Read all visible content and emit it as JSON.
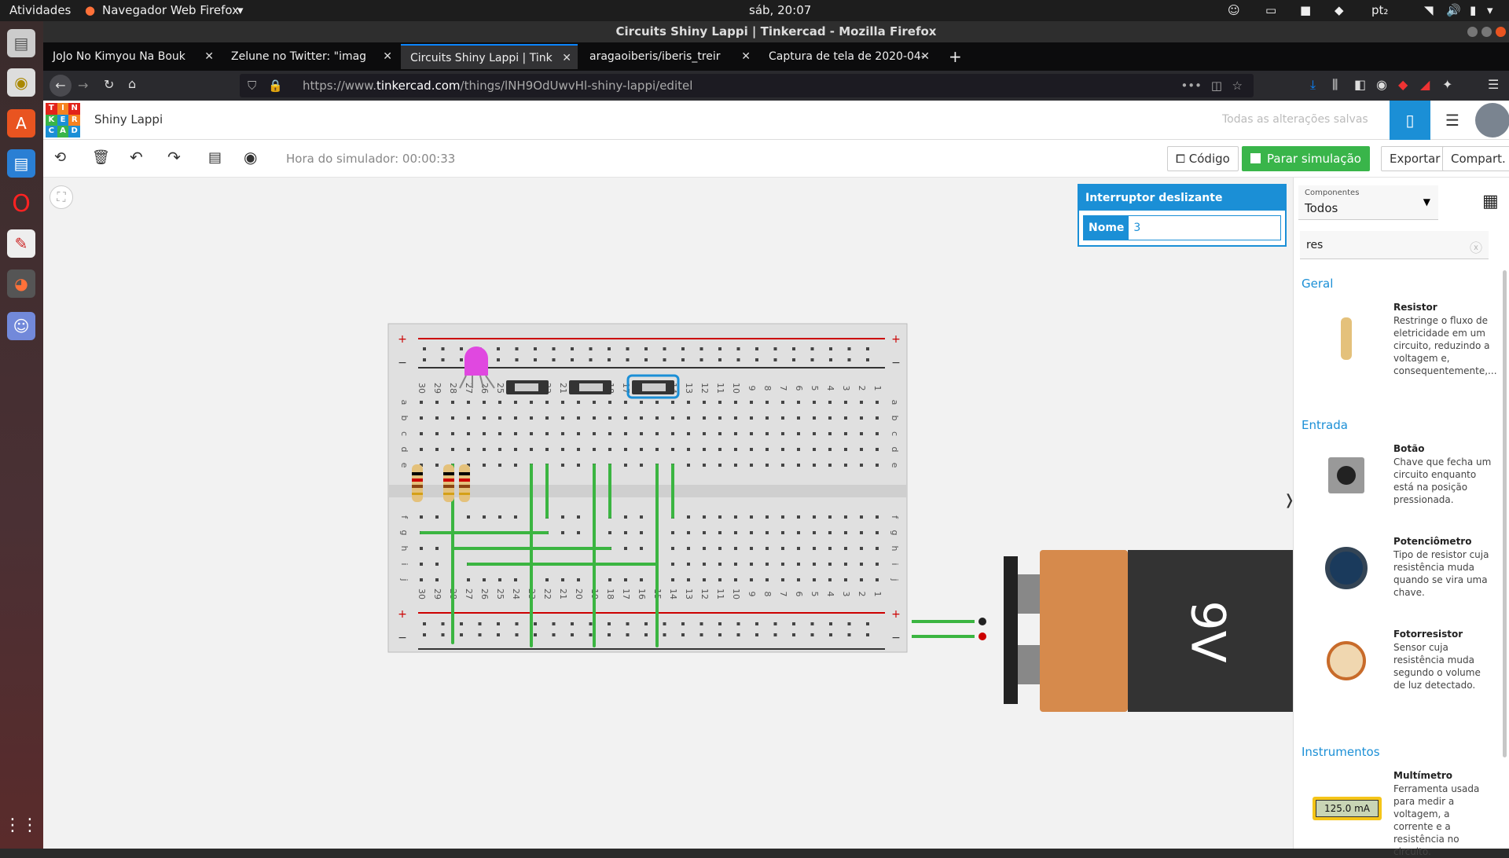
{
  "os": {
    "activities": "Atividades",
    "app_menu": "Navegador Web Firefox",
    "clock": "sáb, 20:07",
    "lang": "pt₂"
  },
  "window": {
    "title": "Circuits Shiny Lappi | Tinkercad - Mozilla Firefox"
  },
  "tabs": [
    {
      "label": "JoJo No Kimyou Na Bouk"
    },
    {
      "label": "Zelune no Twitter: \"imag"
    },
    {
      "label": "Circuits Shiny Lappi | Tink"
    },
    {
      "label": "aragaoiberis/iberis_treir"
    },
    {
      "label": "Captura de tela de 2020-04-"
    }
  ],
  "url": {
    "prefix": "https://www.",
    "domain": "tinkercad.com",
    "path": "/things/lNH9OdUwvHl-shiny-lappi/editel"
  },
  "tinkercad": {
    "logo": [
      "TIN",
      "KER",
      "CAD"
    ],
    "project": "Shiny Lappi",
    "saved": "Todas as alterações salvas"
  },
  "toolbar": {
    "sim_time": "Hora do simulador: 00:00:33",
    "code": "Código",
    "stop": "Parar simulação",
    "export": "Exportar",
    "share": "Compart."
  },
  "inspector": {
    "title": "Interruptor deslizante",
    "name_label": "Nome",
    "name_value": "3"
  },
  "components": {
    "filter_label": "Componentes",
    "filter_value": "Todos",
    "search": "res"
  },
  "categories": {
    "general": "Geral",
    "input": "Entrada",
    "instruments": "Instrumentos"
  },
  "items": [
    {
      "name": "Resistor",
      "desc": "Restringe o fluxo de eletricidade em um circuito, reduzindo a voltagem e, consequentemente,..."
    },
    {
      "name": "Botão",
      "desc": "Chave que fecha um circuito enquanto está na posição pressionada."
    },
    {
      "name": "Potenciômetro",
      "desc": "Tipo de resistor cuja resistência muda quando se vira uma chave."
    },
    {
      "name": "Fotorresistor",
      "desc": "Sensor cuja resistência muda segundo o volume de luz detectado."
    },
    {
      "name": "Multímetro",
      "desc": "Ferramenta usada para medir a voltagem, a corrente e a resistência no circuito."
    }
  ],
  "multimeter_reading": "125.0 mA",
  "battery_label": "9V",
  "breadboard": {
    "columns": [
      "30",
      "29",
      "28",
      "27",
      "26",
      "25",
      "24",
      "23",
      "22",
      "21",
      "20",
      "19",
      "18",
      "17",
      "16",
      "15",
      "14",
      "13",
      "12",
      "11",
      "10",
      "9",
      "8",
      "7",
      "6",
      "5",
      "4",
      "3",
      "2",
      "1"
    ],
    "rows_top": [
      "a",
      "b",
      "c",
      "d",
      "e"
    ],
    "rows_bottom": [
      "f",
      "g",
      "h",
      "i",
      "j"
    ]
  }
}
